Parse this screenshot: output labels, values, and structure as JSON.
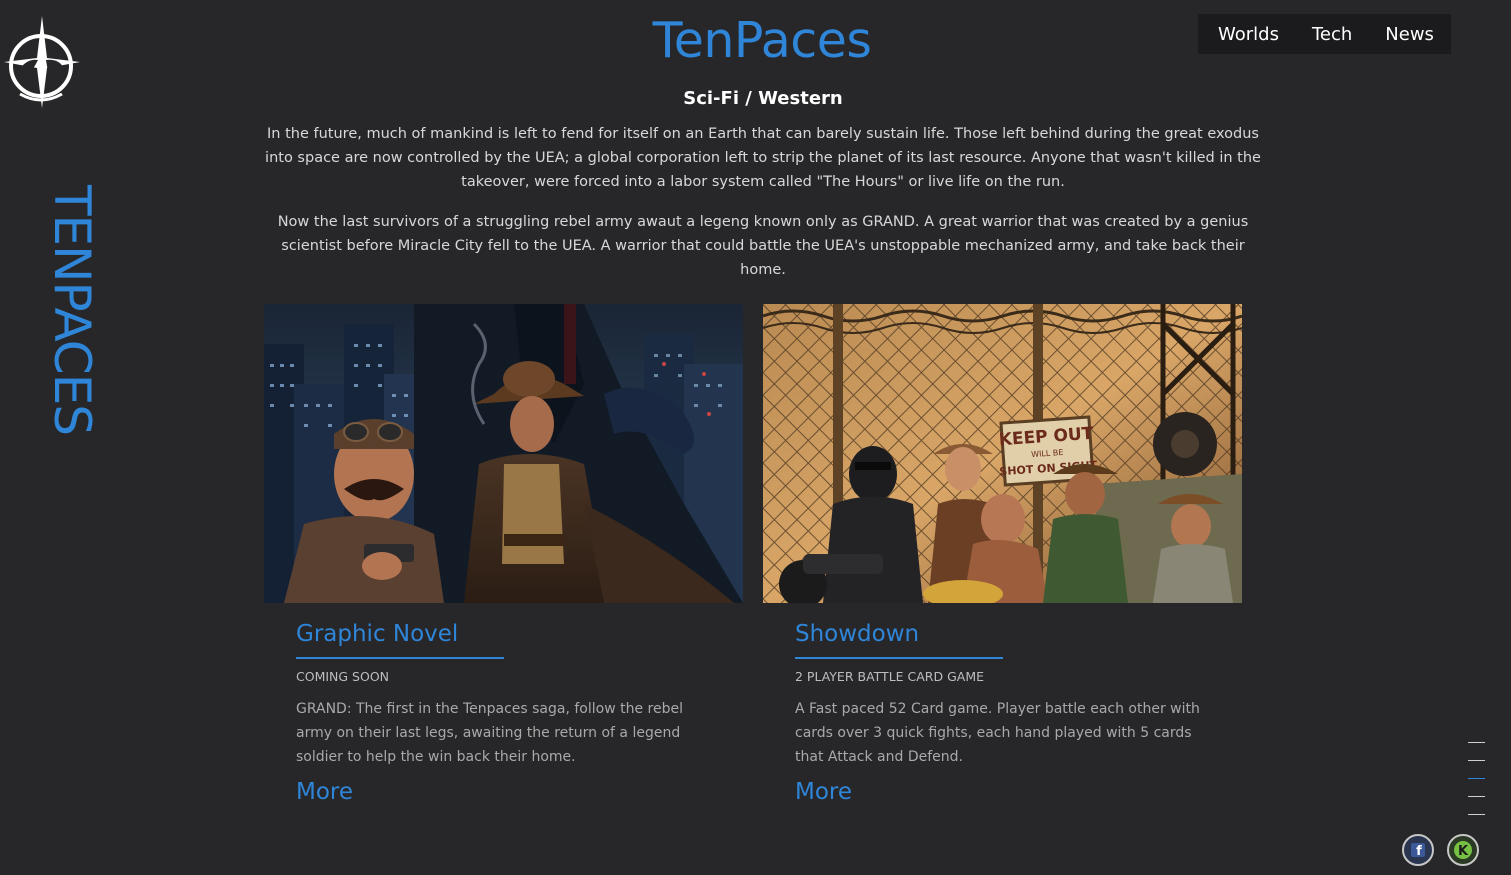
{
  "site": {
    "title": "TenPaces",
    "vertical_name": "TENPACES"
  },
  "nav": {
    "items": [
      "Worlds",
      "Tech",
      "News"
    ]
  },
  "intro": {
    "genre": "Sci-Fi / Western",
    "paragraphs": [
      "In the future, much of mankind is left to fend for itself on an Earth that can barely sustain life. Those left behind during the great exodus into space are now controlled by the UEA; a global corporation left to strip the planet of its last resource. Anyone that wasn't killed in the takeover, were forced into a labor system called \"The Hours\" or live life on the run.",
      "Now the last survivors of a struggling rebel army awaut a legeng known only as GRAND. A great warrior that was created by a genius scientist before Miracle City fell to the UEA. A warrior that could battle the UEA's unstoppable mechanized army, and take back their home."
    ]
  },
  "cards": [
    {
      "title": "Graphic Novel",
      "subtitle": "Coming Soon",
      "description": "GRAND: The first in the Tenpaces saga, follow the rebel army on their last legs, awaiting the return of a legend soldier to help the win back their home.",
      "more": "More"
    },
    {
      "title": "Showdown",
      "subtitle": "2 Player Battle Card Game",
      "description": "A Fast paced 52 Card game. Player battle each other with cards over 3 quick fights, each hand played with 5 cards that Attack and Defend.",
      "more": "More",
      "sign_text": [
        "KEEP OUT",
        "WILL BE",
        "SHOT ON SIGHT"
      ]
    }
  ],
  "pager": {
    "count": 5,
    "active_index": 2
  },
  "social": {
    "icons": [
      "facebook-icon",
      "kickstarter-icon"
    ],
    "facebook_letter": "f",
    "kickstarter_letter": "K"
  },
  "colors": {
    "accent": "#2f86d8",
    "background": "#27272a",
    "nav_background": "#1b1b1d"
  }
}
